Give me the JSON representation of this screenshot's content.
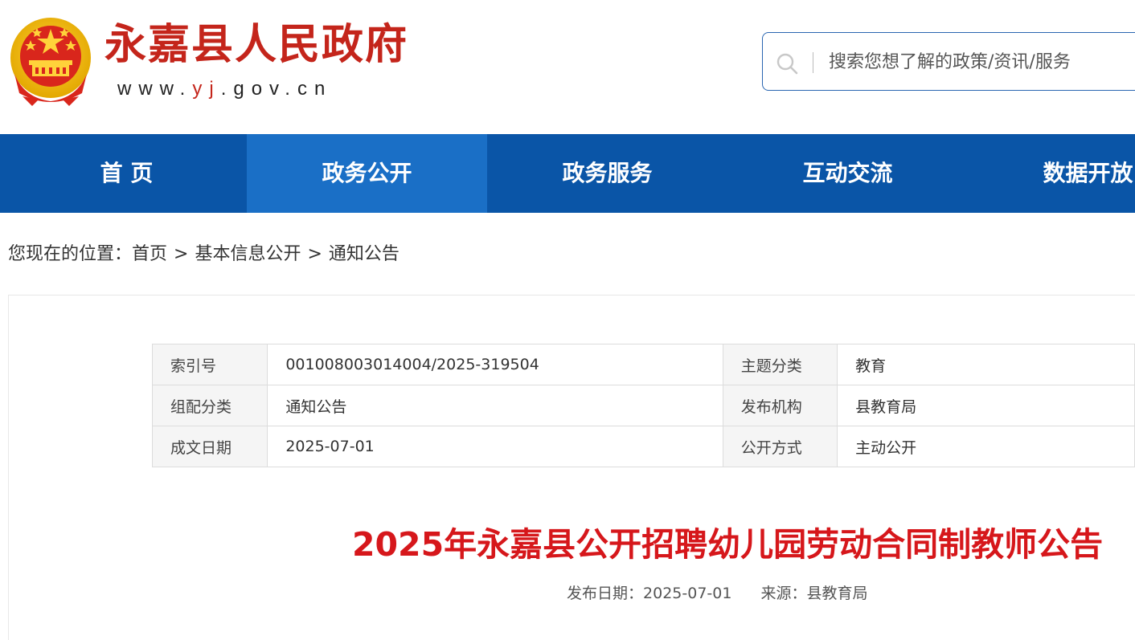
{
  "header": {
    "site_title": "永嘉县人民政府",
    "site_url_prefix": "www.",
    "site_url_highlight": "yj",
    "site_url_suffix": ".gov.cn",
    "emblem_icon": "national-emblem-icon",
    "search": {
      "placeholder": "搜索您想了解的政策/资讯/服务",
      "value": "",
      "icon": "search-icon"
    }
  },
  "nav": {
    "items": [
      {
        "label": "首 页",
        "active": false
      },
      {
        "label": "政务公开",
        "active": true
      },
      {
        "label": "政务服务",
        "active": false
      },
      {
        "label": "互动交流",
        "active": false
      },
      {
        "label": "数据开放",
        "active": false
      }
    ]
  },
  "breadcrumb": {
    "prefix": "您现在的位置：",
    "items": [
      "首页",
      "基本信息公开",
      "通知公告"
    ],
    "separator": ">"
  },
  "meta_table": {
    "rows": [
      {
        "k1": "索引号",
        "v1": "001008003014004/2025-319504",
        "k2": "主题分类",
        "v2": "教育"
      },
      {
        "k1": "组配分类",
        "v1": "通知公告",
        "k2": "发布机构",
        "v2": "县教育局"
      },
      {
        "k1": "成文日期",
        "v1": "2025-07-01",
        "k2": "公开方式",
        "v2": "主动公开"
      }
    ]
  },
  "article": {
    "title": "2025年永嘉县公开招聘幼儿园劳动合同制教师公告",
    "publish_label": "发布日期：",
    "publish_date": "2025-07-01",
    "source_label": "来源：",
    "source": "县教育局"
  },
  "colors": {
    "nav_bg": "#0a55a7",
    "nav_active_bg": "#1a6fc6",
    "brand_red": "#c4251b",
    "title_red": "#d6171b"
  }
}
